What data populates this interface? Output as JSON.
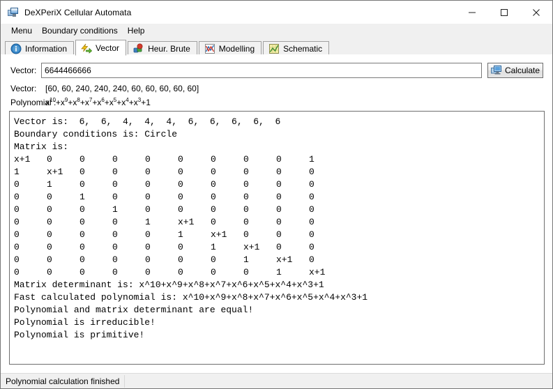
{
  "window": {
    "title": "DeXPeriX Cellular Automata",
    "icon": "monitor-icon",
    "controls": {
      "minimize": "minimize-icon",
      "maximize": "maximize-icon",
      "close": "close-icon"
    }
  },
  "menubar": {
    "items": [
      {
        "label": "Menu",
        "name": "menu-item-menu"
      },
      {
        "label": "Boundary conditions",
        "name": "menu-item-boundary-conditions"
      },
      {
        "label": "Help",
        "name": "menu-item-help"
      }
    ]
  },
  "tabs": {
    "active_index": 1,
    "items": [
      {
        "label": "Information",
        "icon": "info-icon"
      },
      {
        "label": "Vector",
        "icon": "vector-arrow-icon"
      },
      {
        "label": "Heur. Brute",
        "icon": "cubes-icon"
      },
      {
        "label": "Modelling",
        "icon": "chart-icon"
      },
      {
        "label": "Schematic",
        "icon": "schematic-icon"
      }
    ]
  },
  "form": {
    "vector_label": "Vector:",
    "vector_value": "6644466666",
    "vector_placeholder": "",
    "calculate_label": "Calculate",
    "calculate_icon": "monitor-icon"
  },
  "summary": {
    "vector_label": "Vector:",
    "vector_value": "[60, 60, 240, 240, 240, 60, 60, 60, 60, 60]",
    "polynomial_label": "Polynomial :",
    "polynomial_html": "x<sup>10</sup>+x<sup>9</sup>+x<sup>8</sup>+x<sup>7</sup>+x<sup>6</sup>+x<sup>5</sup>+x<sup>4</sup>+x<sup>3</sup>+1"
  },
  "output": {
    "line_vector": "Vector is:  6,  6,  4,  4,  4,  6,  6,  6,  6,  6",
    "line_boundary": "Boundary conditions is: Circle",
    "line_matrix_header": "Matrix is:",
    "matrix": [
      [
        "x+1",
        "0",
        "0",
        "0",
        "0",
        "0",
        "0",
        "0",
        "0",
        "1"
      ],
      [
        "1",
        "x+1",
        "0",
        "0",
        "0",
        "0",
        "0",
        "0",
        "0",
        "0"
      ],
      [
        "0",
        "1",
        "0",
        "0",
        "0",
        "0",
        "0",
        "0",
        "0",
        "0"
      ],
      [
        "0",
        "0",
        "1",
        "0",
        "0",
        "0",
        "0",
        "0",
        "0",
        "0"
      ],
      [
        "0",
        "0",
        "0",
        "1",
        "0",
        "0",
        "0",
        "0",
        "0",
        "0"
      ],
      [
        "0",
        "0",
        "0",
        "0",
        "1",
        "x+1",
        "0",
        "0",
        "0",
        "0"
      ],
      [
        "0",
        "0",
        "0",
        "0",
        "0",
        "1",
        "x+1",
        "0",
        "0",
        "0"
      ],
      [
        "0",
        "0",
        "0",
        "0",
        "0",
        "0",
        "1",
        "x+1",
        "0",
        "0"
      ],
      [
        "0",
        "0",
        "0",
        "0",
        "0",
        "0",
        "0",
        "1",
        "x+1",
        "0"
      ],
      [
        "0",
        "0",
        "0",
        "0",
        "0",
        "0",
        "0",
        "0",
        "1",
        "x+1"
      ]
    ],
    "line_determinant": "Matrix determinant is: x^10+x^9+x^8+x^7+x^6+x^5+x^4+x^3+1",
    "line_fast": "Fast calculated polynomial is: x^10+x^9+x^8+x^7+x^6+x^5+x^4+x^3+1",
    "line_equal": "Polynomial and matrix determinant are equal!",
    "line_irreducible": "Polynomial is irreducible!",
    "line_primitive": "Polynomial is primitive!"
  },
  "statusbar": {
    "text": "Polynomial calculation finished"
  },
  "colors": {
    "window_bg": "#f0f0f0",
    "panel_bg": "#ffffff",
    "border": "#6e6e6e",
    "tab_border": "#a0a0a0",
    "text": "#000000"
  }
}
